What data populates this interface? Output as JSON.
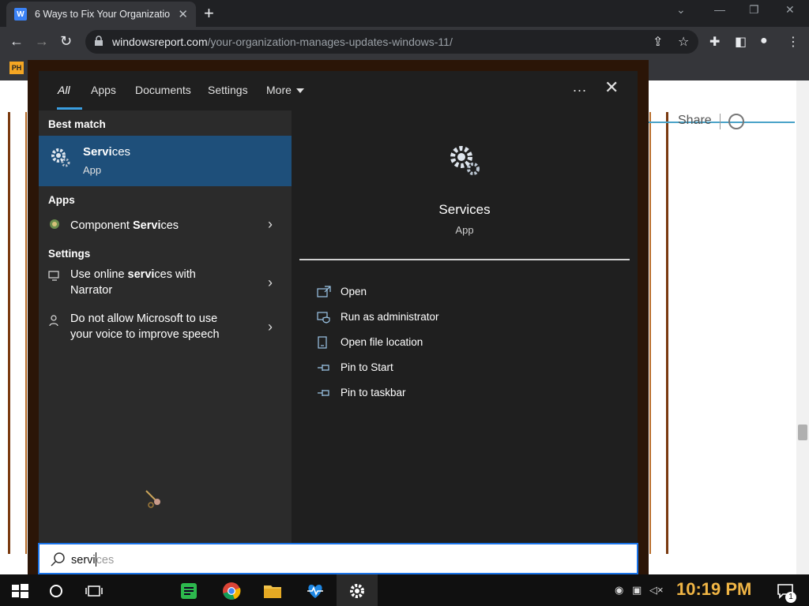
{
  "browser": {
    "tab_title": "6 Ways to Fix Your Organizatio",
    "tab_favicon": "W",
    "url_domain": "windowsreport.com",
    "url_path": "/your-organization-manages-updates-windows-11/",
    "bookmark_label": "PH"
  },
  "page": {
    "share_label": "Share"
  },
  "search": {
    "tabs": [
      "All",
      "Apps",
      "Documents",
      "Settings",
      "More"
    ],
    "more_menu": "...",
    "best_match_header": "Best match",
    "best_match": {
      "name_bold": "Servi",
      "name_rest": "ces",
      "type": "App"
    },
    "apps_header": "Apps",
    "apps": [
      {
        "prefix": "Component ",
        "bold": "Servi",
        "rest": "ces"
      }
    ],
    "settings_header": "Settings",
    "settings": [
      {
        "line1_prefix": "Use online ",
        "line1_bold": "servi",
        "line1_rest": "ces with",
        "line2": "Narrator"
      },
      {
        "line1": "Do not allow Microsoft to use",
        "line2": "your voice to improve speech"
      }
    ],
    "detail": {
      "name": "Services",
      "type": "App",
      "actions": [
        "Open",
        "Run as administrator",
        "Open file location",
        "Pin to Start",
        "Pin to taskbar"
      ]
    },
    "query_typed": "servi",
    "query_ghost": "ces"
  },
  "taskbar": {
    "time": "10:19 PM",
    "notification_count": "1"
  },
  "colors": {
    "accent": "#1e4f7a",
    "clock": "#f0b545",
    "tab_underline": "#3a9ee0"
  }
}
